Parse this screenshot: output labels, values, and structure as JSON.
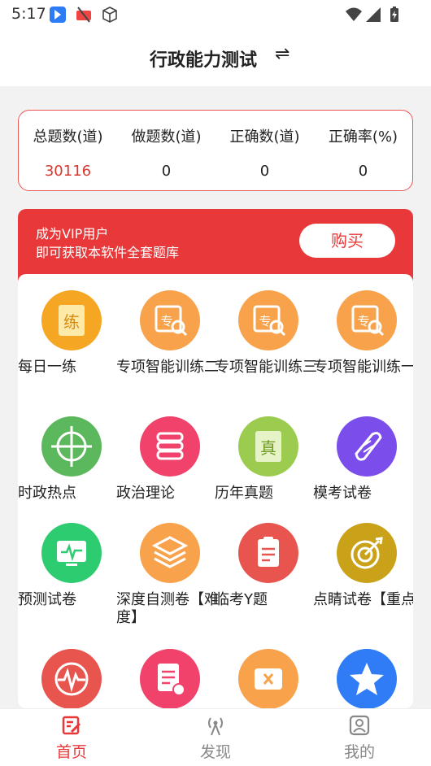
{
  "status": {
    "time": "5:17"
  },
  "header": {
    "title": "行政能力测试",
    "swap_icon": "⇌"
  },
  "stats": [
    {
      "label": "总题数(道)",
      "value": "30116",
      "highlight": true
    },
    {
      "label": "做题数(道)",
      "value": "0"
    },
    {
      "label": "正确数(道)",
      "value": "0"
    },
    {
      "label": "正确率(%)",
      "value": "0"
    }
  ],
  "vip": {
    "line1": "成为VIP用户",
    "line2": "即可获取本软件全套题库",
    "buy_label": "购买"
  },
  "grid": [
    {
      "label": "每日一练",
      "icon": "practice-icon",
      "color": "#f5a623"
    },
    {
      "label": "专项智能训练二",
      "icon": "special-training-icon",
      "color": "#f8a24c"
    },
    {
      "label": "专项智能训练三",
      "icon": "special-training-icon",
      "color": "#f8a24c"
    },
    {
      "label": "专项智能训练一",
      "icon": "special-training-icon",
      "color": "#f8a24c"
    },
    {
      "label": "时政热点",
      "icon": "target-icon",
      "color": "#5cb85c"
    },
    {
      "label": "政治理论",
      "icon": "books-icon",
      "color": "#f0426a"
    },
    {
      "label": "历年真题",
      "icon": "true-exam-icon",
      "color": "#9ccc4f"
    },
    {
      "label": "模考试卷",
      "icon": "scroll-icon",
      "color": "#7b4dea"
    },
    {
      "label": "预测试卷",
      "icon": "monitor-icon",
      "color": "#2ecc71"
    },
    {
      "label": "深度自测卷【难度】",
      "icon": "layers-icon",
      "color": "#f8a24c"
    },
    {
      "label": "临考Y题",
      "icon": "clipboard-icon",
      "color": "#e8544e"
    },
    {
      "label": "点睛试卷【重点】",
      "icon": "bullseye-icon",
      "color": "#c9a21a"
    },
    {
      "label": "",
      "icon": "pulse-icon",
      "color": "#e8544e"
    },
    {
      "label": "",
      "icon": "document-clock-icon",
      "color": "#f0426a"
    },
    {
      "label": "",
      "icon": "wrong-questions-icon",
      "color": "#f8a24c"
    },
    {
      "label": "",
      "icon": "star-icon",
      "color": "#2f7cf6"
    }
  ],
  "tabs": [
    {
      "label": "首页",
      "icon": "home-edit-icon",
      "active": true
    },
    {
      "label": "发现",
      "icon": "broadcast-icon"
    },
    {
      "label": "我的",
      "icon": "profile-icon"
    }
  ],
  "colors": {
    "accent": "#e8383a"
  }
}
